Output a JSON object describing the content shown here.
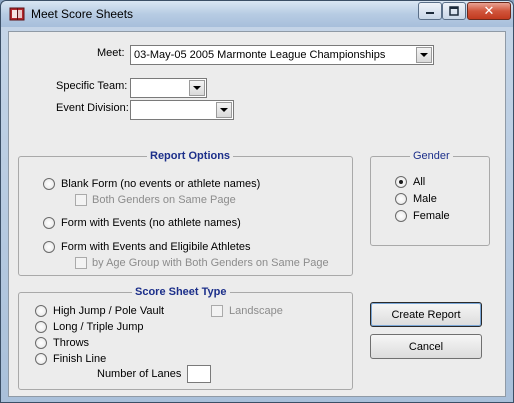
{
  "window": {
    "title": "Meet Score Sheets"
  },
  "titlebar": {
    "close_glyph": "✕"
  },
  "form": {
    "meet_label": "Meet:",
    "meet_value": "03-May-05 2005 Marmonte League Championships",
    "team_label": "Specific Team:",
    "team_value": "",
    "division_label": "Event Division:",
    "division_value": ""
  },
  "report_options": {
    "legend": "Report Options",
    "blank_form": "Blank Form (no events or athlete names)",
    "both_genders": "Both Genders on Same Page",
    "form_with_events": "Form with Events  (no athlete names)",
    "form_with_athletes": "Form with Events  and Eligibile Athletes",
    "by_age_group": "by Age Group with Both Genders on Same Page"
  },
  "gender": {
    "legend": "Gender",
    "options": [
      "All",
      "Male",
      "Female"
    ],
    "selected": "All"
  },
  "score_sheet_type": {
    "legend": "Score  Sheet Type",
    "options": [
      "High Jump / Pole Vault",
      "Long / Triple Jump",
      "Throws",
      "Finish Line"
    ],
    "landscape": "Landscape",
    "lanes_label": "Number of Lanes",
    "lanes_value": ""
  },
  "buttons": {
    "create": "Create Report",
    "cancel": "Cancel"
  },
  "colors": {
    "legend_blue": "#1c2f8a",
    "close_red": "#c23a1f"
  },
  "icons": {
    "app": "score-sheet-book-icon",
    "minimize": "minimize-icon",
    "maximize": "maximize-icon",
    "close": "close-icon",
    "dropdown": "chevron-down-icon"
  }
}
